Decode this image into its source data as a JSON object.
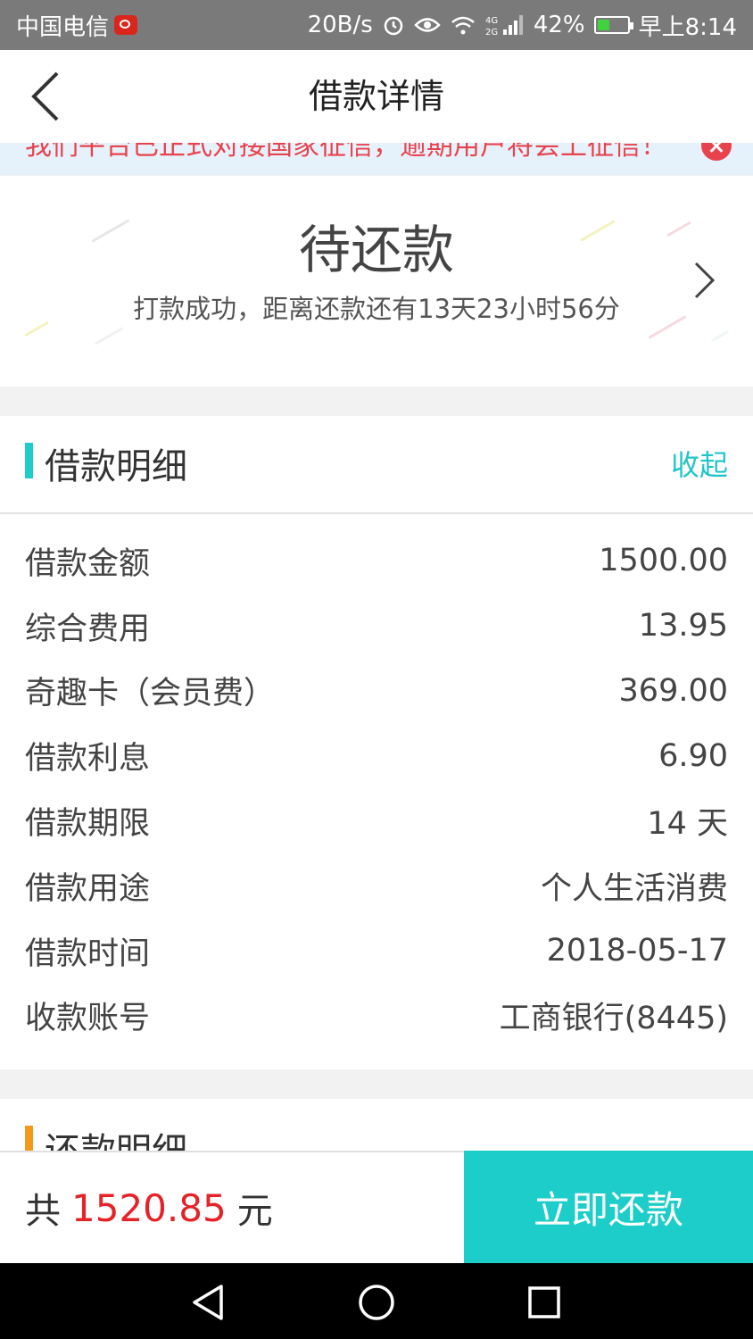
{
  "status_bar": {
    "carrier": "中国电信",
    "net_speed": "20B/s",
    "signal_label": "4G 2G",
    "battery": "42%",
    "battery_level": 0.42,
    "time": "早上8:14"
  },
  "nav": {
    "title": "借款详情",
    "back_icon": "chevron-left-icon"
  },
  "notice": {
    "text": "我们平台已正式对接国家征信，逾期用户将会上征信！",
    "close_icon": "close-icon"
  },
  "loan_status": {
    "title": "待还款",
    "subtitle": "打款成功，距离还款还有13天23小时56分",
    "arrow_icon": "chevron-right-icon"
  },
  "loan_detail": {
    "section_title": "借款明细",
    "collapse_label": "收起",
    "accent_color": "#1dcdc9",
    "rows": [
      {
        "label": "借款金额",
        "value": "1500.00"
      },
      {
        "label": "综合费用",
        "value": "13.95"
      },
      {
        "label": "奇趣卡（会员费）",
        "value": "369.00"
      },
      {
        "label": "借款利息",
        "value": "6.90"
      },
      {
        "label": "借款期限",
        "value": "14 天"
      },
      {
        "label": "借款用途",
        "value": "个人生活消费"
      },
      {
        "label": "借款时间",
        "value": "2018-05-17"
      },
      {
        "label": "收款账号",
        "value": "工商银行(8445)"
      }
    ]
  },
  "repay_detail": {
    "section_title": "还款明细",
    "accent_color": "#f39a1e"
  },
  "footer": {
    "total_prefix": "共",
    "total_amount": "1520.85",
    "total_unit": "元",
    "pay_button": "立即还款",
    "amount_color": "#e52228",
    "button_color": "#1dcdc9"
  },
  "system_nav": [
    "back-triangle-icon",
    "home-circle-icon",
    "recents-square-icon"
  ]
}
